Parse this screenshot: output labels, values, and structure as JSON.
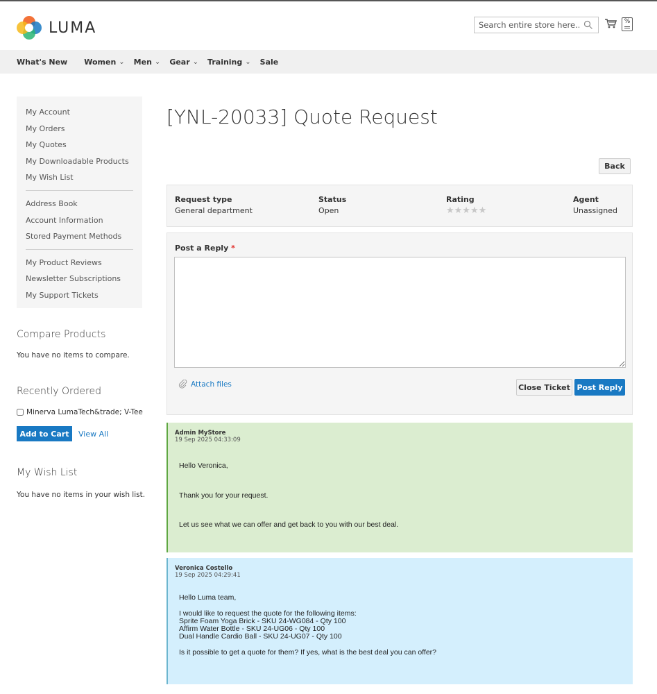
{
  "header": {
    "logo_text": "LUMA",
    "search_placeholder": "Search entire store here...",
    "compare_glyph": "%"
  },
  "nav": {
    "items": [
      {
        "label": "What's New",
        "has_dropdown": false
      },
      {
        "label": "Women",
        "has_dropdown": true
      },
      {
        "label": "Men",
        "has_dropdown": true
      },
      {
        "label": "Gear",
        "has_dropdown": true
      },
      {
        "label": "Training",
        "has_dropdown": true
      },
      {
        "label": "Sale",
        "has_dropdown": false
      }
    ]
  },
  "sidebar": {
    "group1": [
      "My Account",
      "My Orders",
      "My Quotes",
      "My Downloadable Products",
      "My Wish List"
    ],
    "group2": [
      "Address Book",
      "Account Information",
      "Stored Payment Methods"
    ],
    "group3": [
      "My Product Reviews",
      "Newsletter Subscriptions",
      "My Support Tickets"
    ]
  },
  "compare": {
    "title": "Compare Products",
    "empty_text": "You have no items to compare."
  },
  "recent": {
    "title": "Recently Ordered",
    "item_label": "Minerva LumaTech&trade; V-Tee",
    "add_to_cart": "Add to Cart",
    "view_all": "View All"
  },
  "wishlist": {
    "title": "My Wish List",
    "empty_text": "You have no items in your wish list."
  },
  "main": {
    "title": "[YNL-20033] Quote Request",
    "back_label": "Back",
    "info": {
      "request_type_label": "Request type",
      "request_type_value": "General department",
      "status_label": "Status",
      "status_value": "Open",
      "rating_label": "Rating",
      "rating_stars": "★★★★★",
      "rating_value": 0,
      "agent_label": "Agent",
      "agent_value": "Unassigned"
    },
    "reply": {
      "label": "Post a Reply",
      "required_mark": "*",
      "textarea_value": "",
      "attach_label": "Attach files",
      "close_label": "Close Ticket",
      "post_label": "Post Reply"
    },
    "messages": [
      {
        "author": "Admin MyStore",
        "date": "19 Sep 2025 04:33:09",
        "lines": [
          "Hello Veronica,",
          "Thank you for your request.",
          "Let us see what we can offer and get back to you with our best deal."
        ]
      },
      {
        "author": "Veronica Costello",
        "date": "19 Sep 2025 04:29:41",
        "lines": [
          "Hello Luma team,",
          "I would like to request the quote for the following items:",
          "Sprite Foam Yoga Brick - SKU 24-WG084 - Qty 100",
          "Affirm Water Bottle - SKU 24-UG06 - Qty 100",
          "Dual Handle Cardio Ball - SKU 24-UG07 - Qty 100",
          "Is it possible to get a quote for them? If yes, what is the best deal you can offer?"
        ]
      }
    ]
  },
  "colors": {
    "accent": "#1979c3",
    "admin_msg_bg": "#dbedd0",
    "user_msg_bg": "#d4effd",
    "required": "#e02b27"
  }
}
